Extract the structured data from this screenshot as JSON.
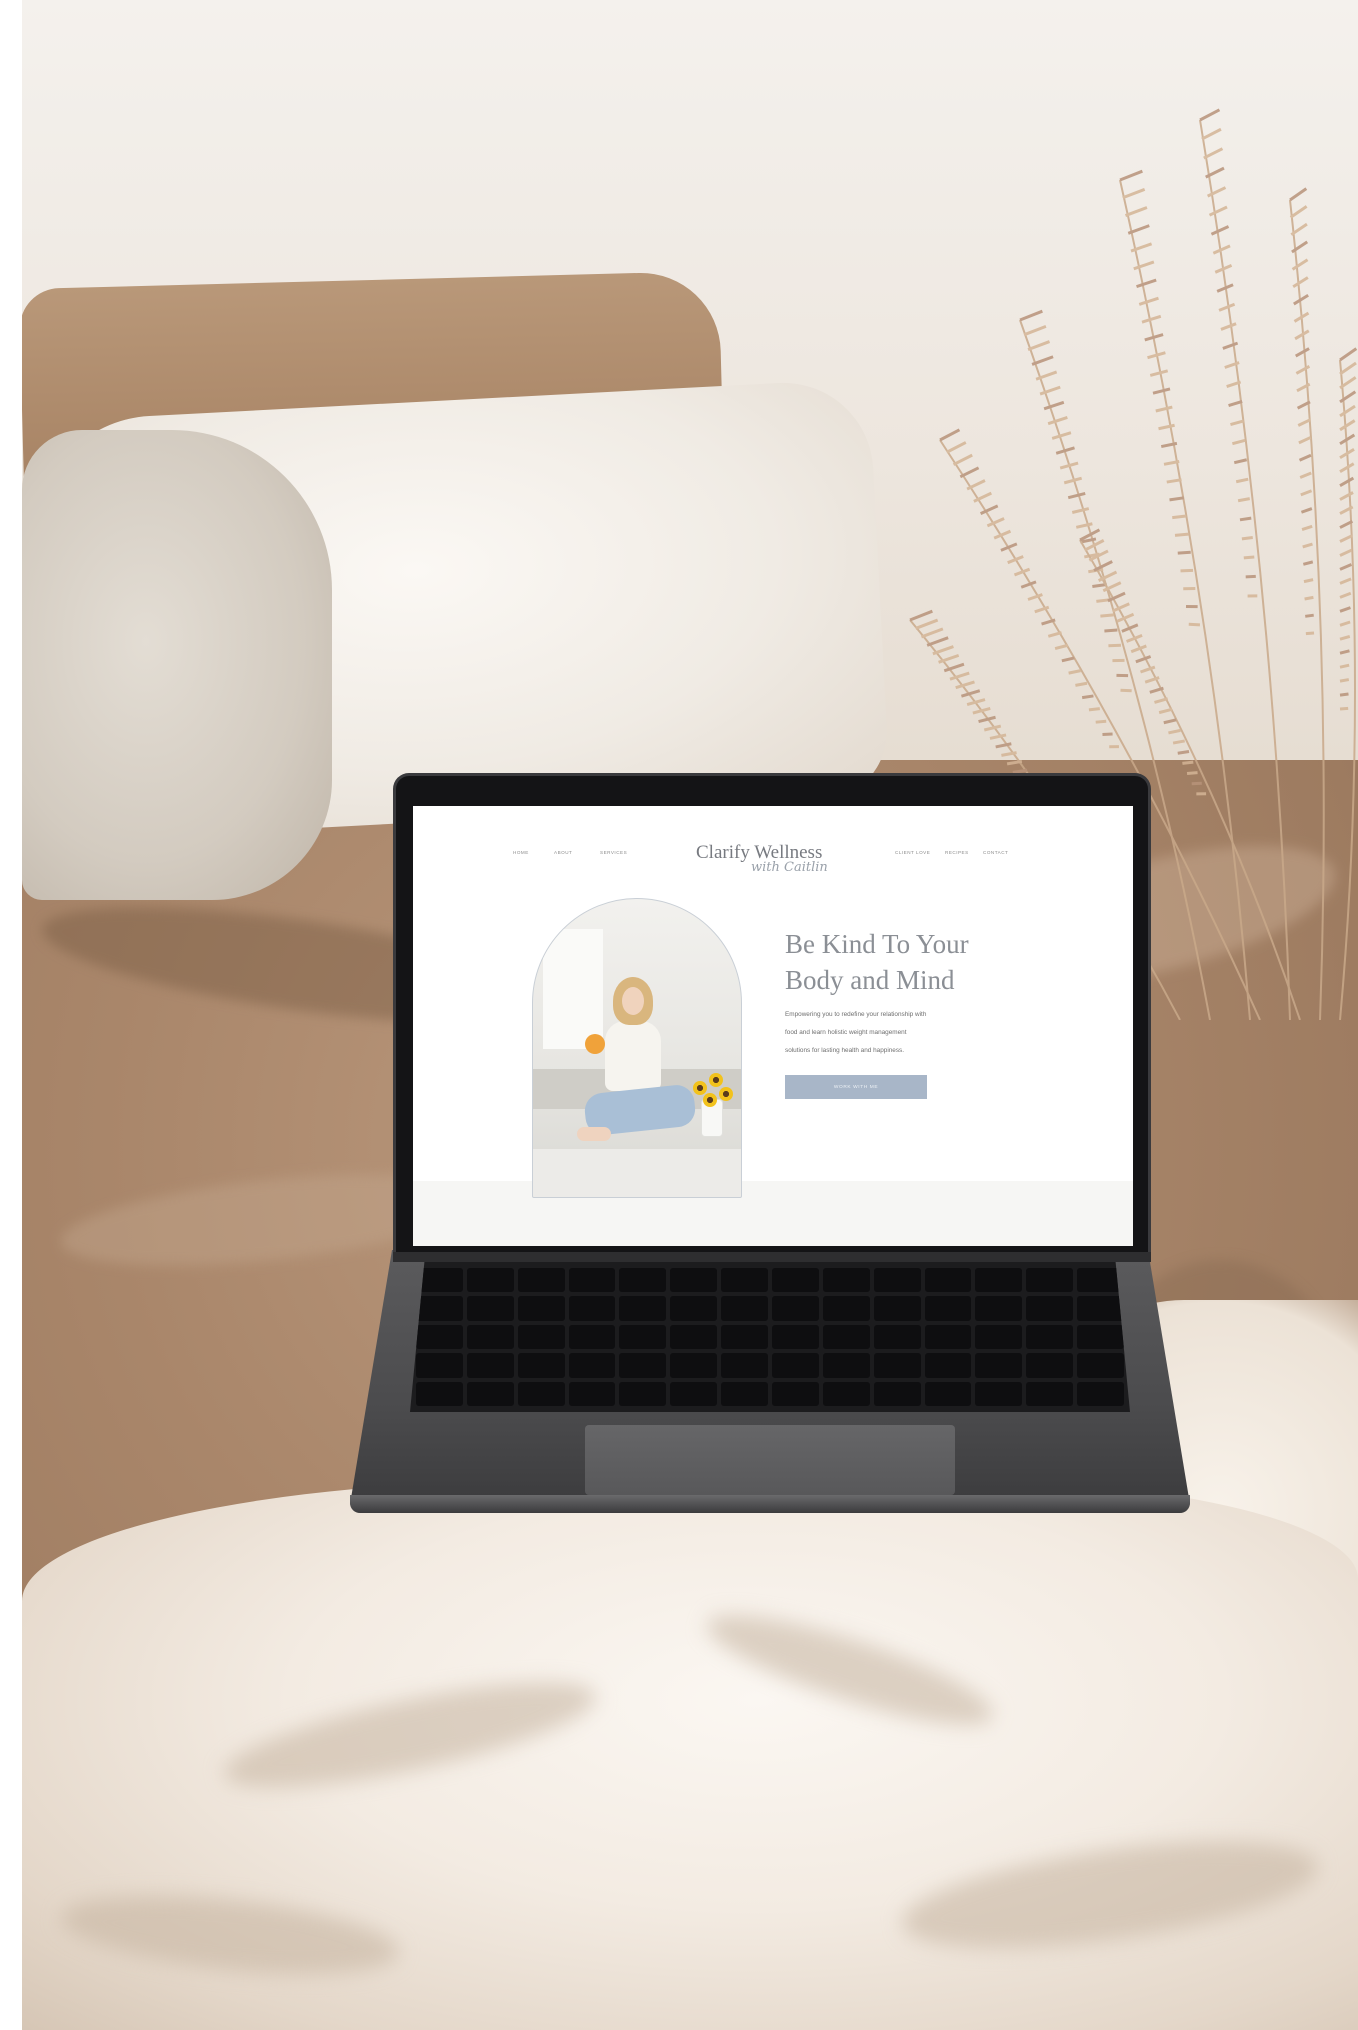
{
  "site": {
    "nav_left": [
      "HOME",
      "ABOUT",
      "SERVICES"
    ],
    "nav_right": [
      "CLIENT LOVE",
      "RECIPES",
      "CONTACT"
    ],
    "logo": {
      "main": "Clarify Wellness",
      "script": "with Caitlin"
    },
    "hero": {
      "title_line1": "Be Kind To Your",
      "title_line2": "Body and Mind",
      "body_line1": "Empowering you to redefine your relationship with",
      "body_line2": "food and learn holistic weight management",
      "body_line3": "solutions for lasting health and happiness.",
      "cta": "WORK WITH ME"
    }
  },
  "colors": {
    "duvet": "#a9866a",
    "fleece": "#f3ebe2",
    "laptop": "#4b4b4d",
    "accent_button": "#a8b6c8",
    "heading_text": "#8b8f95"
  }
}
